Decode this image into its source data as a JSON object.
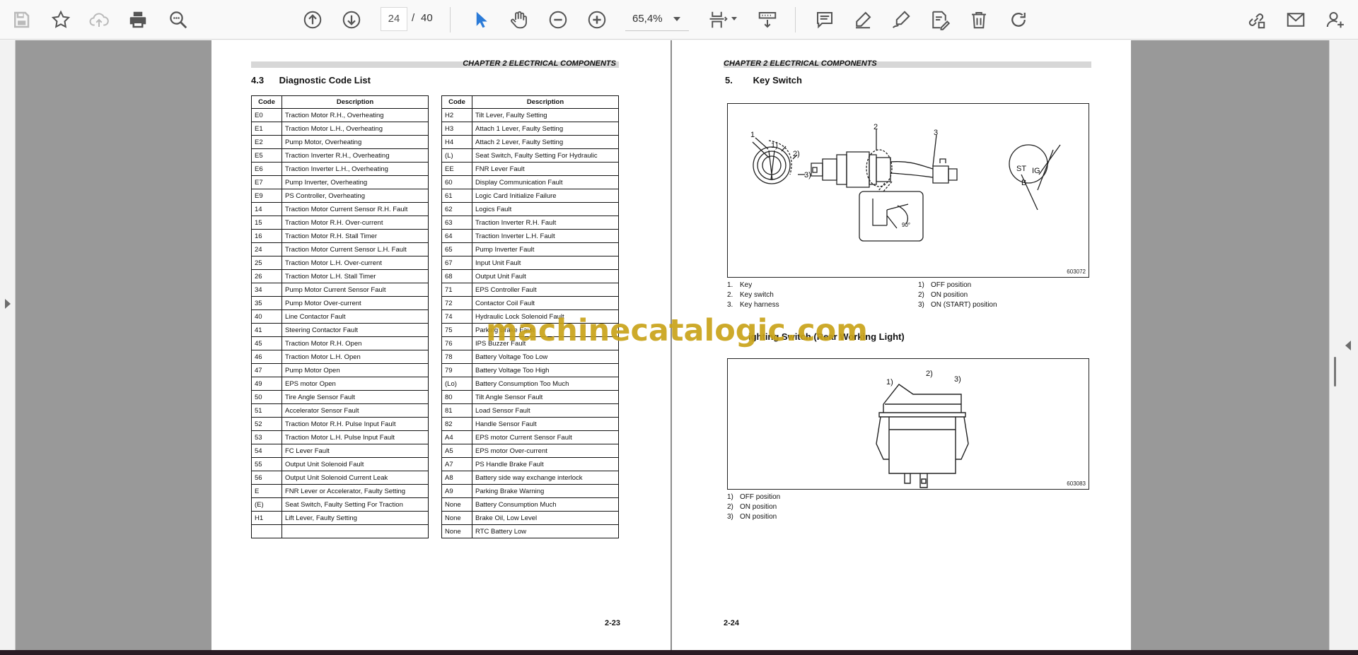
{
  "toolbar": {
    "page_current": "24",
    "page_separator": "/",
    "page_total": "40",
    "zoom": "65,4%"
  },
  "left_page": {
    "chapter_header": "CHAPTER 2 ELECTRICAL COMPONENTS",
    "section_number": "4.3",
    "section_title": "Diagnostic Code List",
    "page_number": "2-23",
    "table_headers": {
      "code": "Code",
      "description": "Description"
    },
    "table1": [
      [
        "E0",
        "Traction Motor R.H., Overheating"
      ],
      [
        "E1",
        "Traction Motor L.H., Overheating"
      ],
      [
        "E2",
        "Pump Motor, Overheating"
      ],
      [
        "E5",
        "Traction Inverter R.H., Overheating"
      ],
      [
        "E6",
        "Traction Inverter L.H., Overheating"
      ],
      [
        "E7",
        "Pump Inverter, Overheating"
      ],
      [
        "E9",
        "PS Controller, Overheating"
      ],
      [
        "14",
        "Traction Motor Current Sensor R.H. Fault"
      ],
      [
        "15",
        "Traction Motor R.H. Over-current"
      ],
      [
        "16",
        "Traction Motor R.H. Stall Timer"
      ],
      [
        "24",
        "Traction Motor Current Sensor L.H. Fault"
      ],
      [
        "25",
        "Traction Motor L.H. Over-current"
      ],
      [
        "26",
        "Traction Motor L.H. Stall Timer"
      ],
      [
        "34",
        "Pump Motor Current Sensor Fault"
      ],
      [
        "35",
        "Pump Motor Over-current"
      ],
      [
        "40",
        "Line Contactor Fault"
      ],
      [
        "41",
        "Steering Contactor Fault"
      ],
      [
        "45",
        "Traction Motor R.H. Open"
      ],
      [
        "46",
        "Traction Motor L.H. Open"
      ],
      [
        "47",
        "Pump Motor Open"
      ],
      [
        "49",
        "EPS motor Open"
      ],
      [
        "50",
        "Tire Angle Sensor Fault"
      ],
      [
        "51",
        "Accelerator Sensor Fault"
      ],
      [
        "52",
        "Traction Motor R.H. Pulse Input Fault"
      ],
      [
        "53",
        "Traction Motor L.H. Pulse Input Fault"
      ],
      [
        "54",
        "FC Lever Fault"
      ],
      [
        "55",
        "Output Unit Solenoid Fault"
      ],
      [
        "56",
        "Output Unit  Solenoid Current Leak"
      ],
      [
        "E",
        "FNR Lever or Accelerator, Faulty Setting"
      ],
      [
        "(E)",
        "Seat Switch, Faulty Setting For Traction"
      ],
      [
        "H1",
        "Lift Lever, Faulty Setting"
      ],
      [
        "",
        ""
      ]
    ],
    "table2": [
      [
        "H2",
        "Tilt Lever, Faulty Setting"
      ],
      [
        "H3",
        "Attach 1 Lever, Faulty Setting"
      ],
      [
        "H4",
        "Attach 2 Lever, Faulty Setting"
      ],
      [
        "(L)",
        "Seat Switch, Faulty Setting For Hydraulic"
      ],
      [
        "EE",
        "FNR Lever Fault"
      ],
      [
        "60",
        "Display Communication Fault"
      ],
      [
        "61",
        "Logic Card Initialize Failure"
      ],
      [
        "62",
        "Logics Fault"
      ],
      [
        "63",
        "Traction Inverter R.H. Fault"
      ],
      [
        "64",
        "Traction Inverter L.H. Fault"
      ],
      [
        "65",
        "Pump Inverter Fault"
      ],
      [
        "67",
        "Input Unit Fault"
      ],
      [
        "68",
        "Output Unit Fault"
      ],
      [
        "71",
        "EPS Controller Fault"
      ],
      [
        "72",
        "Contactor Coil Fault"
      ],
      [
        "74",
        "Hydraulic Lock Solenoid Fault"
      ],
      [
        "75",
        "Parking Brake Fault"
      ],
      [
        "76",
        "IPS Buzzer Fault"
      ],
      [
        "78",
        "Battery Voltage Too Low"
      ],
      [
        "79",
        "Battery Voltage Too High"
      ],
      [
        "(Lo)",
        "Battery Consumption Too Much"
      ],
      [
        "80",
        "Tilt Angle Sensor Fault"
      ],
      [
        "81",
        "Load Sensor Fault"
      ],
      [
        "82",
        "Handle Sensor Fault"
      ],
      [
        "A4",
        "EPS motor Current Sensor Fault"
      ],
      [
        "A5",
        "EPS motor Over-current"
      ],
      [
        "A7",
        "PS Handle Brake Fault"
      ],
      [
        "A8",
        "Battery side way exchange interlock"
      ],
      [
        "A9",
        "Parking Brake Warning"
      ],
      [
        "None",
        "Battery Consumption Much"
      ],
      [
        "None",
        "Brake Oil, Low Level"
      ],
      [
        "None",
        "RTC Battery Low"
      ]
    ]
  },
  "right_page": {
    "chapter_header": "CHAPTER 2 ELECTRICAL COMPONENTS",
    "section_number": "5.",
    "section_title": "Key Switch",
    "page_number": "2-24",
    "figure1": {
      "number": "603072",
      "callouts": [
        "1",
        "1)",
        "2)",
        "3)",
        "2",
        "3",
        "ST",
        "IG",
        "B",
        "90°"
      ]
    },
    "figure1_legend_left": [
      {
        "n": "1.",
        "text": "Key"
      },
      {
        "n": "2.",
        "text": "Key switch"
      },
      {
        "n": "3.",
        "text": "Key harness"
      }
    ],
    "figure1_legend_right": [
      {
        "n": "1)",
        "text": "OFF position"
      },
      {
        "n": "2)",
        "text": "ON position"
      },
      {
        "n": "3)",
        "text": "ON (START) position"
      }
    ],
    "section2_title": "Lighting Switch (Rear Working Light)",
    "section2_visible": "ighting Switch (Rear Working Light)",
    "figure2": {
      "number": "603083",
      "callouts": [
        "1)",
        "2)",
        "3)"
      ]
    },
    "figure2_legend": [
      {
        "n": "1)",
        "text": "OFF position"
      },
      {
        "n": "2)",
        "text": "ON position"
      },
      {
        "n": "3)",
        "text": "ON position"
      }
    ]
  },
  "watermark": "machinecatalogic.com",
  "colors": {
    "toolbar_bg": "#f9f9f9",
    "viewer_bg": "#999999",
    "accent_blue": "#2b7bd8",
    "watermark": "#c9a31a"
  }
}
